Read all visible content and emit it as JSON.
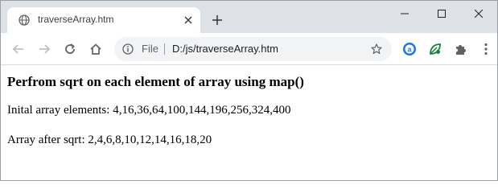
{
  "browser": {
    "tab": {
      "title": "traverseArray.htm"
    },
    "address_bar": {
      "scheme_label": "File",
      "url": "D:/js/traverseArray.htm"
    }
  },
  "page": {
    "heading": "Perfrom sqrt on each element of array using map()",
    "initial_line": "Inital array elements: 4,16,36,64,100,144,196,256,324,400",
    "result_line": "Array after sqrt: 2,4,6,8,10,12,14,16,18,20"
  },
  "icons": {
    "favicon": "globe-icon",
    "tab_close": "close-icon",
    "new_tab": "plus-icon",
    "minimize": "minimize-icon",
    "maximize": "maximize-icon",
    "close_window": "close-icon",
    "back": "arrow-left-icon",
    "forward": "arrow-right-icon",
    "reload": "reload-icon",
    "home": "home-icon",
    "site_info": "info-icon",
    "bookmark": "star-icon",
    "extension_1": "a-circle-icon",
    "extension_2": "leaf-icon",
    "extensions": "puzzle-icon",
    "menu": "kebab-menu-icon"
  },
  "colors": {
    "tabstrip_bg": "#dee1e6",
    "omnibox_bg": "#f1f3f4",
    "extension_blue": "#1a73e8",
    "extension_green": "#188038",
    "icon_gray": "#5f6368"
  }
}
